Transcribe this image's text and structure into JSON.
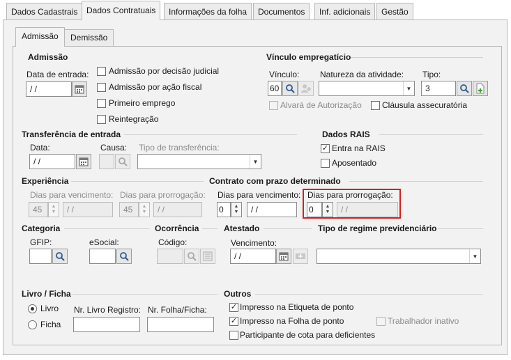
{
  "top_tabs": [
    {
      "label": "Dados Cadastrais"
    },
    {
      "label": "Dados Contratuais"
    },
    {
      "label": "Informações da folha"
    },
    {
      "label": "Documentos"
    },
    {
      "label": "Inf. adicionais"
    },
    {
      "label": "Gestão"
    }
  ],
  "sub_tabs": [
    {
      "label": "Admissão"
    },
    {
      "label": "Demissão"
    }
  ],
  "admissao": {
    "title": "Admissão",
    "data_entrada_label": "Data de entrada:",
    "data_entrada_value": " / /",
    "checks": [
      {
        "label": "Admissão por decisão judicial",
        "checked": false
      },
      {
        "label": "Admissão por ação fiscal",
        "checked": false
      },
      {
        "label": "Primeiro emprego",
        "checked": false
      },
      {
        "label": "Reintegração",
        "checked": false
      }
    ]
  },
  "vinculo": {
    "title": "Vínculo empregatício",
    "vinculo_label": "Vínculo:",
    "vinculo_value": "60",
    "natureza_label": "Natureza da atividade:",
    "natureza_value": "",
    "tipo_label": "Tipo:",
    "tipo_value": "3",
    "alvara_label": "Alvará de Autorização",
    "clausula_label": "Cláusula assecuratória"
  },
  "transferencia": {
    "title": "Transferência de entrada",
    "data_label": "Data:",
    "data_value": " / /",
    "causa_label": "Causa:",
    "tipo_label": "Tipo de transferência:"
  },
  "rais": {
    "title": "Dados RAIS",
    "entra_label": "Entra na RAIS",
    "entra_checked": true,
    "aposentado_label": "Aposentado",
    "aposentado_checked": false
  },
  "experiencia": {
    "title": "Experiência",
    "venc_label": "Dias para vencimento:",
    "venc_value": "45",
    "venc_date": " / /",
    "prorr_label": "Dias para prorrogação:",
    "prorr_value": "45",
    "prorr_date": " / /"
  },
  "contrato": {
    "title": "Contrato com prazo determinado",
    "venc_label": "Dias para vencimento:",
    "venc_value": "0",
    "venc_date": " / /",
    "prorr_label": "Dias para prorrogação:",
    "prorr_value": "0",
    "prorr_date": " / /"
  },
  "categoria": {
    "title": "Categoria",
    "gfip_label": "GFIP:",
    "esocial_label": "eSocial:"
  },
  "ocorrencia": {
    "title": "Ocorrência",
    "codigo_label": "Código:"
  },
  "atestado": {
    "title": "Atestado",
    "venc_label": "Vencimento:",
    "venc_value": " / /"
  },
  "regime": {
    "title": "Tipo de regime previdenciário"
  },
  "livro": {
    "title": "Livro / Ficha",
    "livro_label": "Livro",
    "ficha_label": "Ficha",
    "nr_livro_label": "Nr. Livro Registro:",
    "nr_folha_label": "Nr. Folha/Ficha:"
  },
  "outros": {
    "title": "Outros",
    "items": [
      {
        "label": "Impresso na Etiqueta de ponto",
        "checked": true
      },
      {
        "label": "Impresso na Folha de ponto",
        "checked": true
      },
      {
        "label": "Trabalhador inativo",
        "checked": false
      },
      {
        "label": "Participante de cota para deficientes",
        "checked": false
      }
    ]
  }
}
